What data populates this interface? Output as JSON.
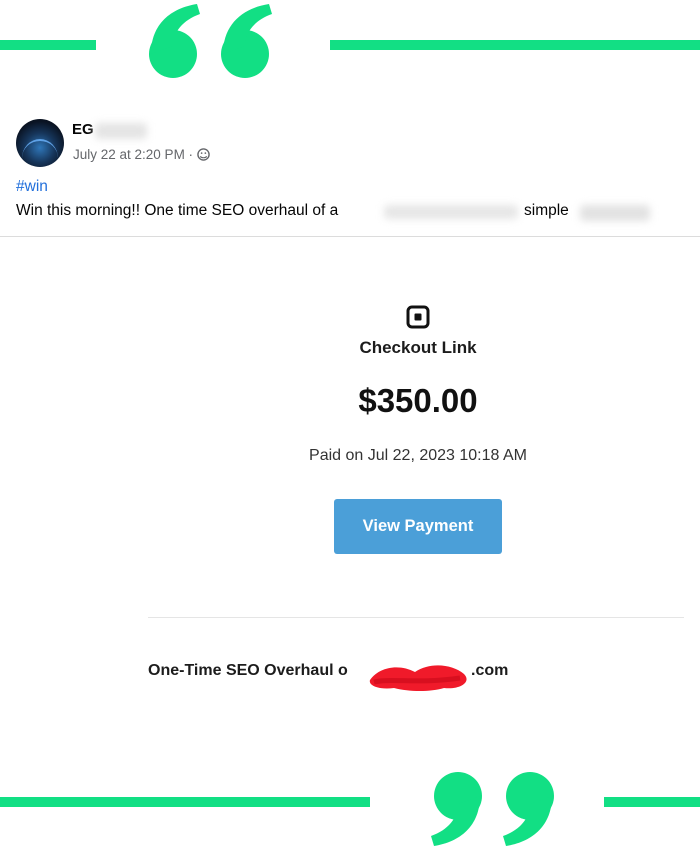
{
  "colors": {
    "accent_green": "#12df84",
    "button_blue": "#4b9fd8",
    "link_blue": "#216fdb"
  },
  "post": {
    "author_name": "EG",
    "timestamp": "July 22 at 2:20 PM ·",
    "privacy_icon": "globe-icon",
    "hashtag": "#win",
    "text_start": "Win this morning!! One time SEO overhaul of a",
    "text_end": "simple"
  },
  "receipt": {
    "logo_icon": "square-logo-icon",
    "title": "Checkout Link",
    "amount": "$350.00",
    "paid_on": "Paid on Jul 22, 2023 10:18 AM",
    "button_label": "View Payment",
    "item_name": "One-Time SEO Overhaul o",
    "item_domain": ".com"
  }
}
